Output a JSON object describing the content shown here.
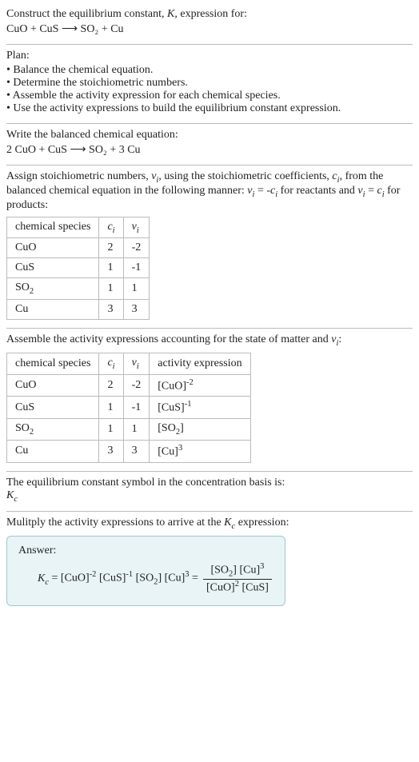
{
  "intro": {
    "line1": "Construct the equilibrium constant, K, expression for:",
    "equation": "CuO + CuS ⟶ SO₂ + Cu"
  },
  "plan": {
    "heading": "Plan:",
    "items": [
      "• Balance the chemical equation.",
      "• Determine the stoichiometric numbers.",
      "• Assemble the activity expression for each chemical species.",
      "• Use the activity expressions to build the equilibrium constant expression."
    ]
  },
  "balanced": {
    "heading": "Write the balanced chemical equation:",
    "equation": "2 CuO + CuS ⟶ SO₂ + 3 Cu"
  },
  "stoich": {
    "para_a": "Assign stoichiometric numbers, νᵢ, using the stoichiometric coefficients, cᵢ, from the balanced chemical equation in the following manner: νᵢ = -cᵢ for reactants and νᵢ = cᵢ for products:",
    "headers": {
      "species": "chemical species",
      "ci": "cᵢ",
      "vi": "νᵢ"
    },
    "rows": [
      {
        "species": "CuO",
        "ci": "2",
        "vi": "-2"
      },
      {
        "species": "CuS",
        "ci": "1",
        "vi": "-1"
      },
      {
        "species": "SO₂",
        "ci": "1",
        "vi": "1"
      },
      {
        "species": "Cu",
        "ci": "3",
        "vi": "3"
      }
    ]
  },
  "activity": {
    "heading": "Assemble the activity expressions accounting for the state of matter and νᵢ:",
    "headers": {
      "species": "chemical species",
      "ci": "cᵢ",
      "vi": "νᵢ",
      "expr": "activity expression"
    },
    "rows": [
      {
        "species": "CuO",
        "ci": "2",
        "vi": "-2",
        "expr": "[CuO]⁻²"
      },
      {
        "species": "CuS",
        "ci": "1",
        "vi": "-1",
        "expr": "[CuS]⁻¹"
      },
      {
        "species": "SO₂",
        "ci": "1",
        "vi": "1",
        "expr": "[SO₂]"
      },
      {
        "species": "Cu",
        "ci": "3",
        "vi": "3",
        "expr": "[Cu]³"
      }
    ]
  },
  "symbol": {
    "heading": "The equilibrium constant symbol in the concentration basis is:",
    "value": "K𝒸"
  },
  "multiply": {
    "heading": "Mulitply the activity expressions to arrive at the K𝒸 expression:"
  },
  "answer": {
    "label": "Answer:",
    "lhs": "K𝒸 = [CuO]⁻² [CuS]⁻¹ [SO₂] [Cu]³ =",
    "frac_num": "[SO₂] [Cu]³",
    "frac_den": "[CuO]² [CuS]"
  }
}
